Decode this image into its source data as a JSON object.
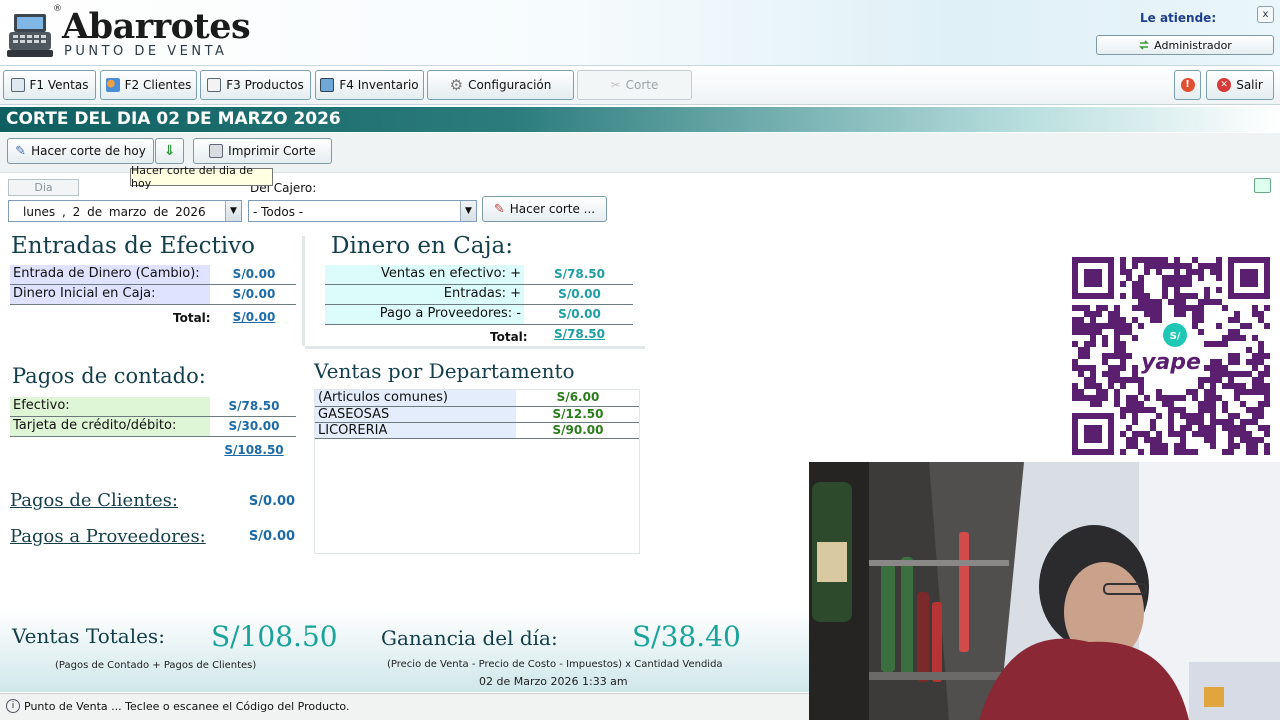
{
  "header": {
    "app_title": "Abarrotes",
    "app_subtitle": "PUNTO DE VENTA",
    "registered_mark": "®",
    "attend_label": "Le atiende:",
    "user_button": "Administrador",
    "close_label": "x"
  },
  "toolbar": {
    "ventas": "F1 Ventas",
    "clientes": "F2 Clientes",
    "productos": "F3 Productos",
    "inventario": "F4 Inventario",
    "configuracion": "Configuración",
    "corte": "Corte",
    "salir": "Salir"
  },
  "title": "CORTE DEL DIA 02 DE MARZO 2026",
  "actions": {
    "hacer_corte_hoy": "Hacer corte de hoy",
    "imprimir": "Imprimir Corte",
    "tooltip": "Hacer corte del dia de hoy"
  },
  "filters": {
    "dia_tab": "Dia",
    "cajero_label": "Del Cajero:",
    "date_value": "lunes , 2 de marzo de 2026",
    "cajero_value": "- Todos -",
    "hacer_corte_btn": "Hacer corte ..."
  },
  "entradas": {
    "heading": "Entradas de Efectivo",
    "rows": [
      {
        "label": "Entrada de Dinero (Cambio):",
        "value": "S/0.00"
      },
      {
        "label": "Dinero Inicial en Caja:",
        "value": "S/0.00"
      }
    ],
    "total_label": "Total:",
    "total_value": "S/0.00"
  },
  "dinero_caja": {
    "heading": "Dinero en Caja:",
    "rows": [
      {
        "label": "Ventas en efectivo: +",
        "value": "S/78.50"
      },
      {
        "label": "Entradas: +",
        "value": "S/0.00"
      },
      {
        "label": "Pago a Proveedores: -",
        "value": "S/0.00"
      }
    ],
    "total_label": "Total:",
    "total_value": "S/78.50"
  },
  "pagos_contado": {
    "heading": "Pagos de contado:",
    "rows": [
      {
        "label": "Efectivo:",
        "value": "S/78.50"
      },
      {
        "label": "Tarjeta de crédito/débito:",
        "value": "S/30.00"
      }
    ],
    "total_value": "S/108.50"
  },
  "ventas_departamento": {
    "heading": "Ventas por Departamento",
    "rows": [
      {
        "label": "(Articulos comunes)",
        "value": "S/6.00"
      },
      {
        "label": "GASEOSAS",
        "value": "S/12.50"
      },
      {
        "label": "LICORERIA",
        "value": "S/90.00"
      }
    ]
  },
  "pagos_clientes": {
    "label": "Pagos de Clientes:",
    "value": "S/0.00"
  },
  "pagos_proveedores": {
    "label": "Pagos a Proveedores:",
    "value": "S/0.00"
  },
  "totals": {
    "ventas_label": "Ventas Totales:",
    "ventas_value": "S/108.50",
    "ventas_note": "(Pagos de Contado + Pagos de Clientes)",
    "ganancia_label": "Ganancia del día:",
    "ganancia_value": "S/38.40",
    "ganancia_note": "(Precio de Venta - Precio de Costo - Impuestos) x Cantidad Vendida",
    "timestamp": "02 de Marzo 2026 1:33 am"
  },
  "status": "Punto de Venta ... Teclee o escanee el Código del Producto.",
  "qr": {
    "badge": "S/",
    "brand": "yape"
  },
  "colors": {
    "accent": "#1aa39b",
    "title_bar": "#0f5f61",
    "value_blue": "#1d6aa6",
    "value_green": "#2b7d1d"
  }
}
